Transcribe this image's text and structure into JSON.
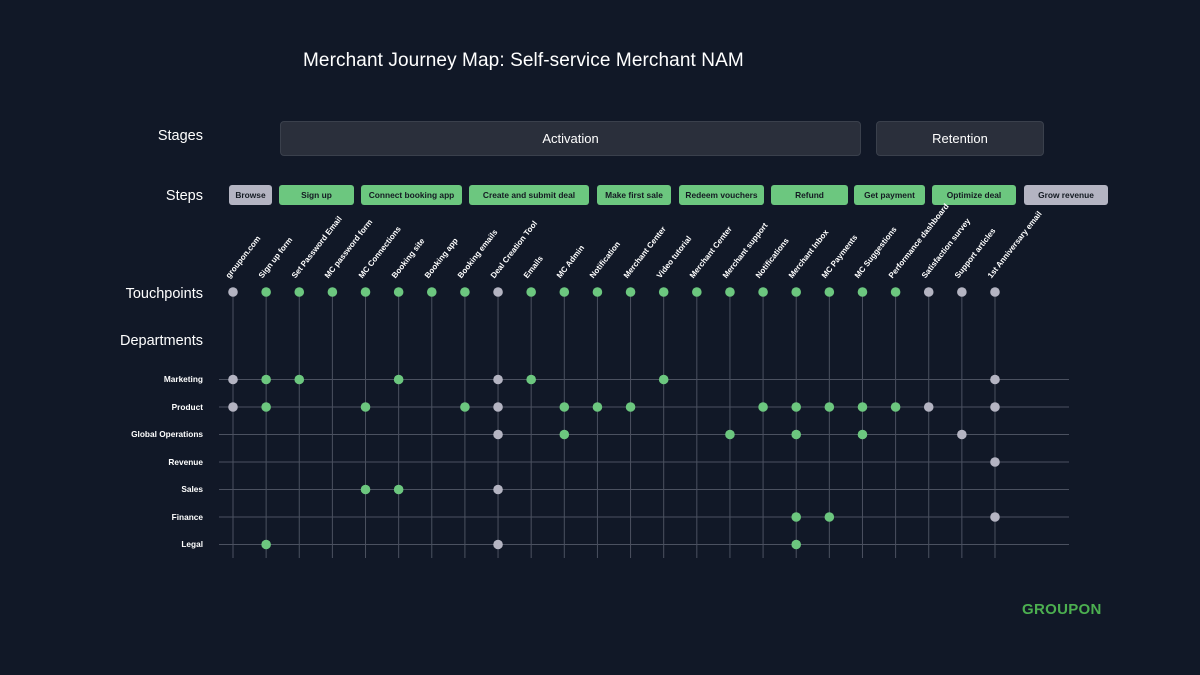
{
  "title": "Merchant Journey Map: Self-service Merchant NAM",
  "row_labels": {
    "stages": "Stages",
    "steps": "Steps",
    "touchpoints": "Touchpoints",
    "departments": "Departments"
  },
  "stages": [
    {
      "label": "Activation"
    },
    {
      "label": "Retention"
    }
  ],
  "steps": [
    {
      "label": "Browse",
      "status": "gray"
    },
    {
      "label": "Sign up",
      "status": "green"
    },
    {
      "label": "Connect booking app",
      "status": "green"
    },
    {
      "label": "Create and submit deal",
      "status": "green"
    },
    {
      "label": "Make first sale",
      "status": "green"
    },
    {
      "label": "Redeem vouchers",
      "status": "green"
    },
    {
      "label": "Refund",
      "status": "green"
    },
    {
      "label": "Get payment",
      "status": "green"
    },
    {
      "label": "Optimize deal",
      "status": "green"
    },
    {
      "label": "Grow revenue",
      "status": "gray"
    }
  ],
  "touchpoints": [
    {
      "label": "groupon.com",
      "status": "gray"
    },
    {
      "label": "Sign up form",
      "status": "green"
    },
    {
      "label": "Set Password Email",
      "status": "green"
    },
    {
      "label": "MC password form",
      "status": "green"
    },
    {
      "label": "MC Connections",
      "status": "green"
    },
    {
      "label": "Booking site",
      "status": "green"
    },
    {
      "label": "Booking app",
      "status": "green"
    },
    {
      "label": "Booking emails",
      "status": "green"
    },
    {
      "label": "Deal Creation Tool",
      "status": "gray"
    },
    {
      "label": "Emails",
      "status": "green"
    },
    {
      "label": "MC Admin",
      "status": "green"
    },
    {
      "label": "Notification",
      "status": "green"
    },
    {
      "label": "Merchant Center",
      "status": "green"
    },
    {
      "label": "Video tutorial",
      "status": "green"
    },
    {
      "label": "Merchant Center",
      "status": "green"
    },
    {
      "label": "Merchant support",
      "status": "green"
    },
    {
      "label": "Notifications",
      "status": "green"
    },
    {
      "label": "Merchant Inbox",
      "status": "green"
    },
    {
      "label": "MC Payments",
      "status": "green"
    },
    {
      "label": "MC Suggestions",
      "status": "green"
    },
    {
      "label": "Performance dashboard",
      "status": "green"
    },
    {
      "label": "Satisfaction survey",
      "status": "gray"
    },
    {
      "label": "Support articles",
      "status": "gray"
    },
    {
      "label": "1st Anniversary email",
      "status": "gray"
    }
  ],
  "departments": [
    {
      "name": "Marketing",
      "marks": [
        [
          0,
          "gray"
        ],
        [
          1,
          "green"
        ],
        [
          2,
          "green"
        ],
        [
          5,
          "green"
        ],
        [
          8,
          "gray"
        ],
        [
          9,
          "green"
        ],
        [
          13,
          "green"
        ],
        [
          23,
          "gray"
        ]
      ]
    },
    {
      "name": "Product",
      "marks": [
        [
          0,
          "gray"
        ],
        [
          1,
          "green"
        ],
        [
          4,
          "green"
        ],
        [
          7,
          "green"
        ],
        [
          8,
          "gray"
        ],
        [
          10,
          "green"
        ],
        [
          11,
          "green"
        ],
        [
          12,
          "green"
        ],
        [
          16,
          "green"
        ],
        [
          17,
          "green"
        ],
        [
          18,
          "green"
        ],
        [
          19,
          "green"
        ],
        [
          20,
          "green"
        ],
        [
          21,
          "gray"
        ],
        [
          23,
          "gray"
        ]
      ]
    },
    {
      "name": "Global Operations",
      "marks": [
        [
          8,
          "gray"
        ],
        [
          10,
          "green"
        ],
        [
          15,
          "green"
        ],
        [
          17,
          "green"
        ],
        [
          19,
          "green"
        ],
        [
          22,
          "gray"
        ]
      ]
    },
    {
      "name": "Revenue",
      "marks": [
        [
          23,
          "gray"
        ]
      ]
    },
    {
      "name": "Sales",
      "marks": [
        [
          4,
          "green"
        ],
        [
          5,
          "green"
        ],
        [
          8,
          "gray"
        ]
      ]
    },
    {
      "name": "Finance",
      "marks": [
        [
          17,
          "green"
        ],
        [
          18,
          "green"
        ],
        [
          23,
          "gray"
        ]
      ]
    },
    {
      "name": "Legal",
      "marks": [
        [
          1,
          "green"
        ],
        [
          8,
          "gray"
        ],
        [
          17,
          "green"
        ]
      ]
    }
  ],
  "brand": "GROUPON",
  "colors": {
    "background": "#111827",
    "green": "#6cc77f",
    "gray": "#b4b4c2",
    "grid_line": "#4b5160",
    "brand": "#4caf50"
  }
}
